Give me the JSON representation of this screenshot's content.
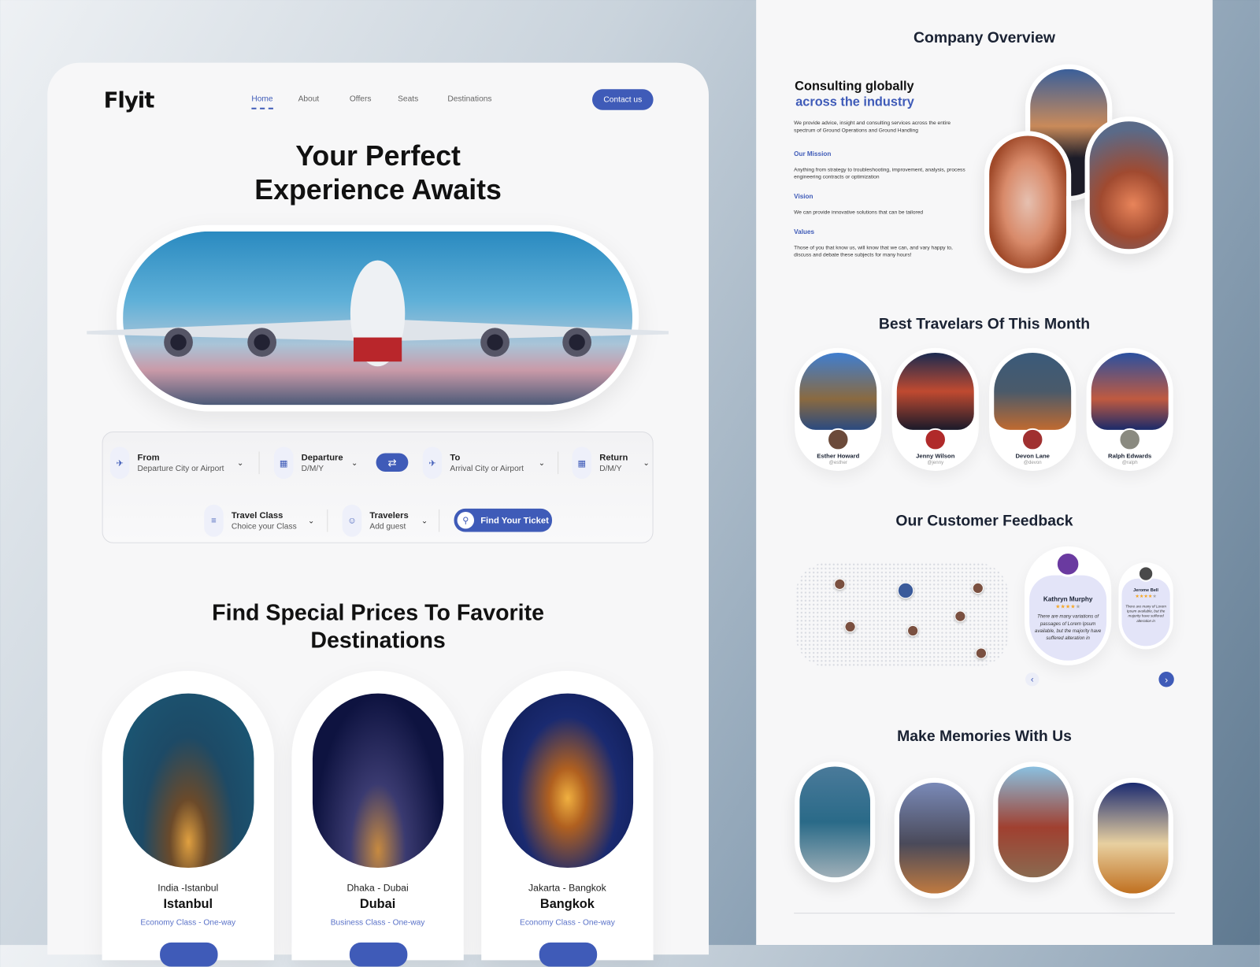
{
  "colors": {
    "accent": "#3f5bb8",
    "star": "#f5a623"
  },
  "header": {
    "logo": "Flyit",
    "nav": [
      "Home",
      "About",
      "Offers",
      "Seats",
      "Destinations"
    ],
    "active": "Home",
    "contact": "Contact us"
  },
  "hero": {
    "title_line1": "Your Perfect",
    "title_line2": "Experience Awaits"
  },
  "search": {
    "from": {
      "label": "From",
      "placeholder": "Departure City or Airport",
      "icon": "plane-takeoff-icon"
    },
    "departure": {
      "label": "Departure",
      "placeholder": "D/M/Y",
      "icon": "calendar-icon"
    },
    "swap_icon": "swap-arrows-icon",
    "to": {
      "label": "To",
      "placeholder": "Arrival City or Airport",
      "icon": "plane-landing-icon"
    },
    "return": {
      "label": "Return",
      "placeholder": "D/M/Y",
      "icon": "calendar-icon"
    },
    "travel_class": {
      "label": "Travel Class",
      "placeholder": "Choice your Class",
      "icon": "filter-icon"
    },
    "travelers": {
      "label": "Travelers",
      "placeholder": "Add guest",
      "icon": "users-icon"
    },
    "submit": "Find Your Ticket"
  },
  "destinations": {
    "title_line1": "Find Special Prices To Favorite",
    "title_line2": "Destinations",
    "items": [
      {
        "route": "India -Istanbul",
        "city": "Istanbul",
        "class": "Economy Class - One-way"
      },
      {
        "route": "Dhaka - Dubai",
        "city": "Dubai",
        "class": "Business Class - One-way"
      },
      {
        "route": "Jakarta - Bangkok",
        "city": "Bangkok",
        "class": "Economy Class - One-way"
      }
    ]
  },
  "overview": {
    "title": "Company Overview",
    "heading1": "Consulting globally",
    "heading2": "across the industry",
    "intro": "We provide advice, insight and consulting services across the entire spectrum of Ground Operations and Ground Handling",
    "sections": [
      {
        "title": "Our Mission",
        "text": "Anything from strategy to troubleshooting, improvement, analysis, process engineering   contracts or optimization"
      },
      {
        "title": "Vision",
        "text": "We can provide innovative solutions that can be tailored"
      },
      {
        "title": "Values",
        "text": "Those of you that know us, will know that we can, and vary happy to, discuss and debate these subjects for many hours!"
      }
    ]
  },
  "travelers": {
    "title": "Best Travelars Of This Month",
    "items": [
      {
        "name": "Esther Howard",
        "handle": "@esther"
      },
      {
        "name": "Jenny Wilson",
        "handle": "@jenny"
      },
      {
        "name": "Devon Lane",
        "handle": "@devon"
      },
      {
        "name": "Ralph Edwards",
        "handle": "@ralph"
      }
    ]
  },
  "feedback": {
    "title": "Our Customer Feedback",
    "items": [
      {
        "name": "Kathryn Murphy",
        "rating": 4,
        "text": "There are many variations of passages of Lorem Ipsum available, but the majority have suffered alteration in"
      },
      {
        "name": "Jerome Bell",
        "rating": 4,
        "text": "There are many of Lorem Ipsum available, but the majority have suffered alteration in"
      }
    ]
  },
  "memories": {
    "title": "Make Memories With Us"
  }
}
